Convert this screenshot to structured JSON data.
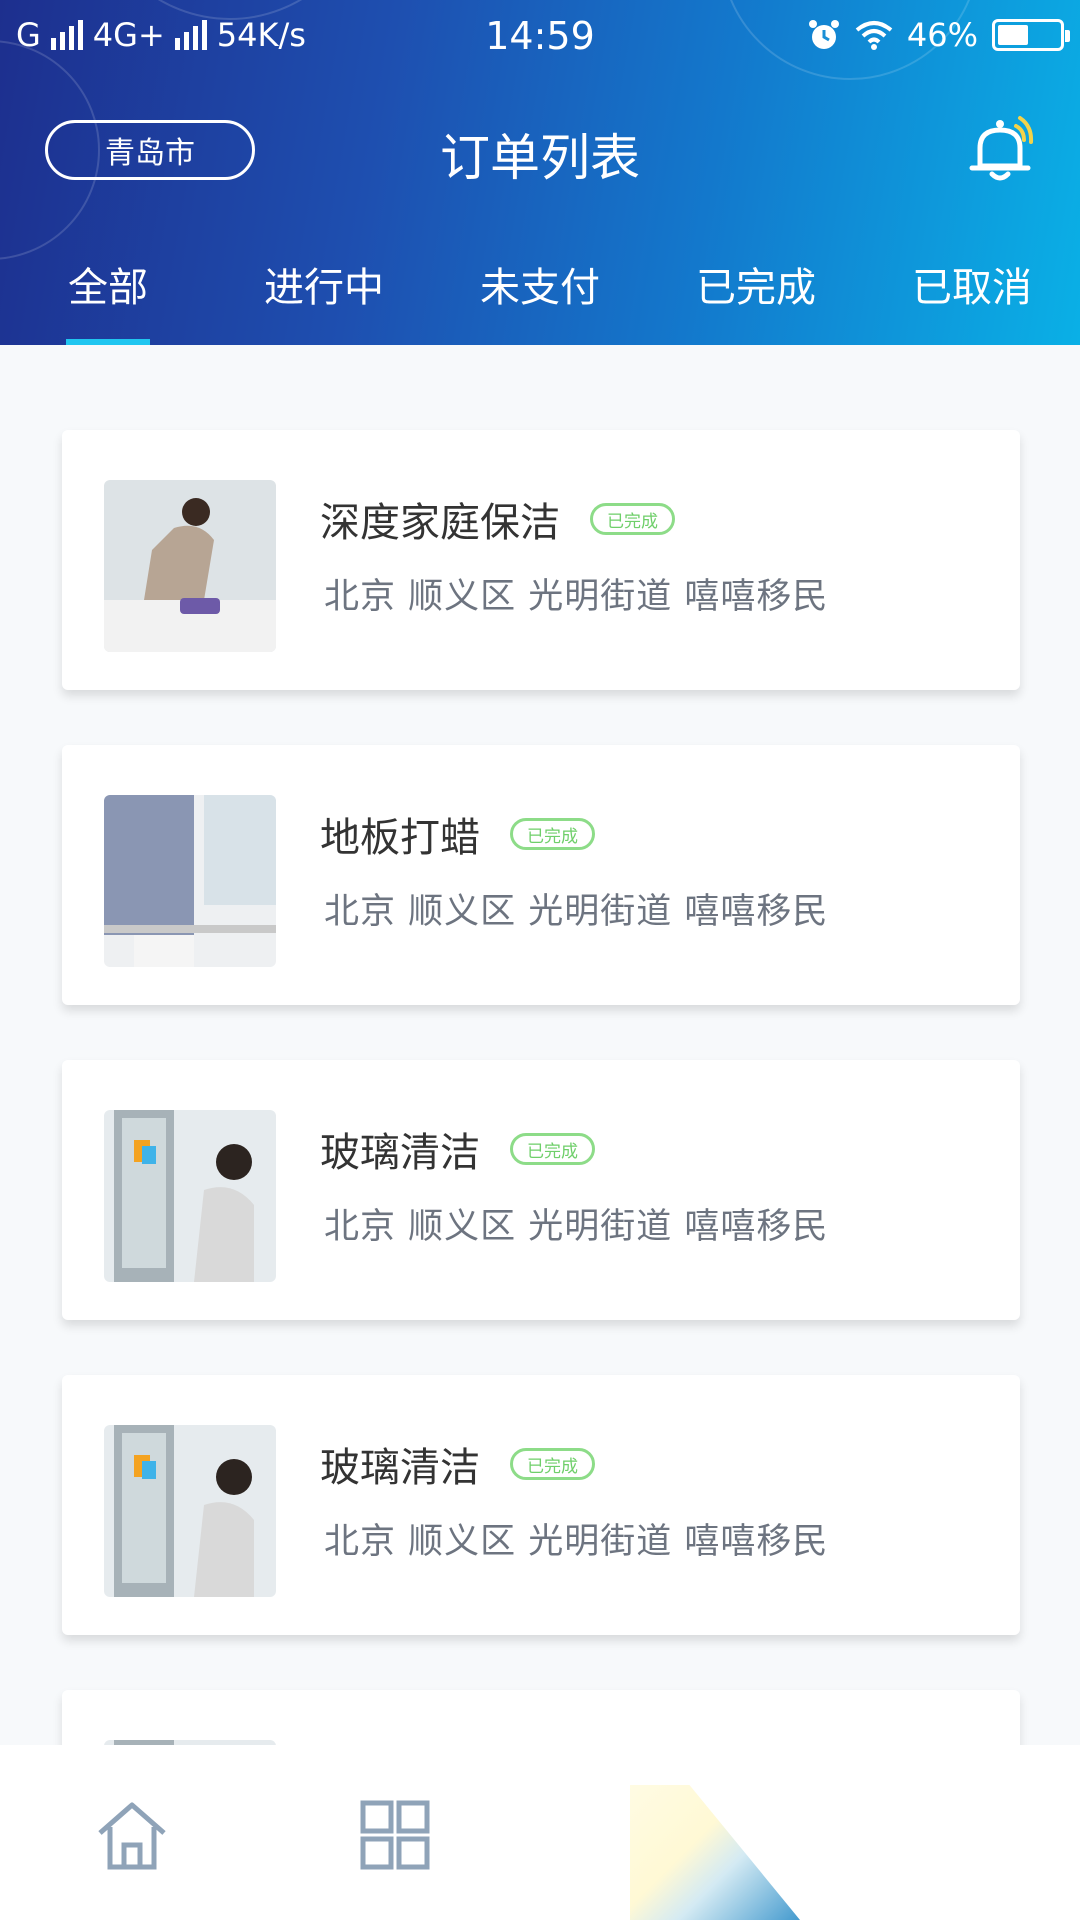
{
  "statusbar": {
    "carrier": "G",
    "network": "4G+",
    "speed": "54K/s",
    "time": "14:59",
    "battery": "46%"
  },
  "header": {
    "city": "青岛市",
    "title": "订单列表",
    "bell_icon": "bell-icon"
  },
  "tabs": [
    {
      "label": "全部",
      "active": true
    },
    {
      "label": "进行中",
      "active": false
    },
    {
      "label": "未支付",
      "active": false
    },
    {
      "label": "已完成",
      "active": false
    },
    {
      "label": "已取消",
      "active": false
    }
  ],
  "orders": [
    {
      "title": "深度家庭保洁",
      "status": "已完成",
      "address": "北京 顺义区 光明街道  嘻嘻移民"
    },
    {
      "title": "地板打蜡",
      "status": "已完成",
      "address": "北京 顺义区 光明街道  嘻嘻移民"
    },
    {
      "title": "玻璃清洁",
      "status": "已完成",
      "address": "北京 顺义区 光明街道  嘻嘻移民"
    },
    {
      "title": "玻璃清洁",
      "status": "已完成",
      "address": "北京 顺义区 光明街道  嘻嘻移民"
    }
  ],
  "colors": {
    "header_start": "#1d2f8e",
    "header_end": "#0ab0e6",
    "tab_indicator": "#20c6f0",
    "badge_green": "#6fcf6a",
    "nav_icon": "#8fa3b8"
  },
  "bottom_nav": {
    "items": [
      "home-icon",
      "grid-icon"
    ]
  }
}
